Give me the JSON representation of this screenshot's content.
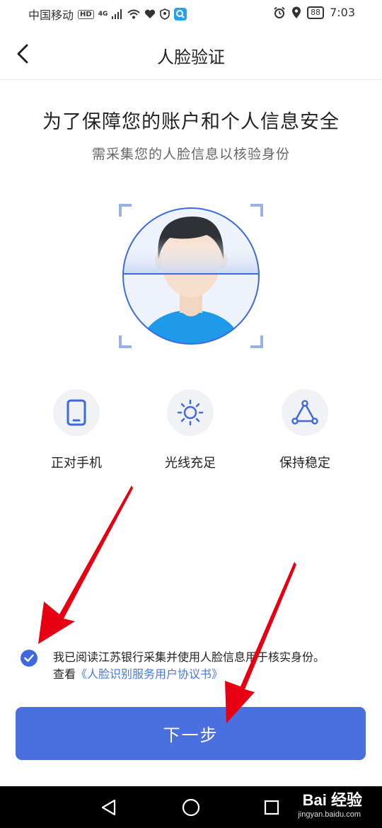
{
  "status_bar": {
    "carrier": "中国移动",
    "hd": "HD",
    "network": "4G",
    "battery": "88",
    "time": "7:03"
  },
  "header": {
    "title": "人脸验证"
  },
  "main": {
    "heading": "为了保障您的账户和个人信息安全",
    "subheading": "需采集您的人脸信息以核验身份",
    "tips": [
      {
        "label": "正对手机",
        "icon": "phone-icon"
      },
      {
        "label": "光线充足",
        "icon": "sun-icon"
      },
      {
        "label": "保持稳定",
        "icon": "triangle-icon"
      }
    ]
  },
  "agreement": {
    "checked": true,
    "line1": "我已阅读江苏银行采集并使用人脸信息用于核实身份。",
    "line2_prefix": "查看",
    "link": "《人脸识别服务用户协议书》"
  },
  "button": {
    "next_label": "下一步"
  },
  "watermark": {
    "brand": "Bai 经验",
    "url": "jingyan.baidu.com"
  },
  "colors": {
    "accent": "#4a6fde",
    "arrow": "#e60012"
  }
}
